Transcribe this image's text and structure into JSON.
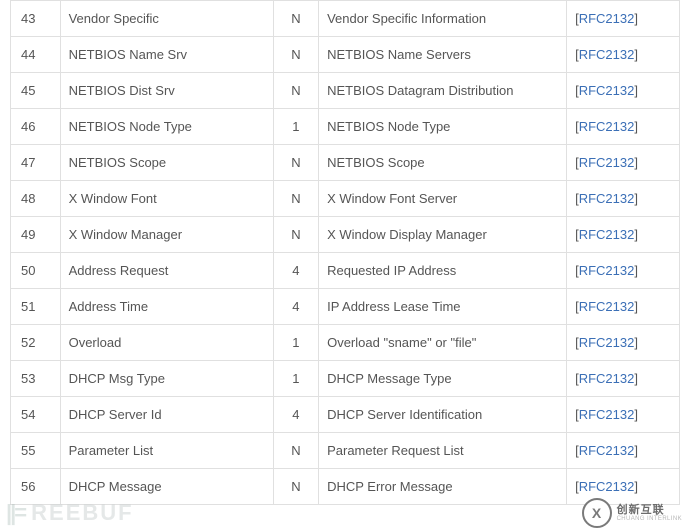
{
  "rows": [
    {
      "code": "43",
      "name": "Vendor Specific",
      "len": "N",
      "meaning": "Vendor Specific Information",
      "ref": "RFC2132"
    },
    {
      "code": "44",
      "name": "NETBIOS Name Srv",
      "len": "N",
      "meaning": "NETBIOS Name Servers",
      "ref": "RFC2132"
    },
    {
      "code": "45",
      "name": "NETBIOS Dist Srv",
      "len": "N",
      "meaning": "NETBIOS Datagram Distribution",
      "ref": "RFC2132"
    },
    {
      "code": "46",
      "name": "NETBIOS Node Type",
      "len": "1",
      "meaning": "NETBIOS Node Type",
      "ref": "RFC2132"
    },
    {
      "code": "47",
      "name": "NETBIOS Scope",
      "len": "N",
      "meaning": "NETBIOS Scope",
      "ref": "RFC2132"
    },
    {
      "code": "48",
      "name": "X Window Font",
      "len": "N",
      "meaning": "X Window Font Server",
      "ref": "RFC2132"
    },
    {
      "code": "49",
      "name": "X Window Manager",
      "len": "N",
      "meaning": "X Window Display Manager",
      "ref": "RFC2132"
    },
    {
      "code": "50",
      "name": "Address Request",
      "len": "4",
      "meaning": "Requested IP Address",
      "ref": "RFC2132"
    },
    {
      "code": "51",
      "name": "Address Time",
      "len": "4",
      "meaning": "IP Address Lease Time",
      "ref": "RFC2132"
    },
    {
      "code": "52",
      "name": "Overload",
      "len": "1",
      "meaning": "Overload \"sname\" or \"file\"",
      "ref": "RFC2132"
    },
    {
      "code": "53",
      "name": "DHCP Msg Type",
      "len": "1",
      "meaning": "DHCP Message Type",
      "ref": "RFC2132"
    },
    {
      "code": "54",
      "name": "DHCP Server Id",
      "len": "4",
      "meaning": "DHCP Server Identification",
      "ref": "RFC2132"
    },
    {
      "code": "55",
      "name": "Parameter List",
      "len": "N",
      "meaning": "Parameter Request List",
      "ref": "RFC2132"
    },
    {
      "code": "56",
      "name": "DHCP Message",
      "len": "N",
      "meaning": "DHCP Error Message",
      "ref": "RFC2132"
    }
  ],
  "watermark_left": "REEBUF",
  "logo": {
    "glyph": "X",
    "zh": "创新互联",
    "en": "CHUANG INTERLINK"
  }
}
